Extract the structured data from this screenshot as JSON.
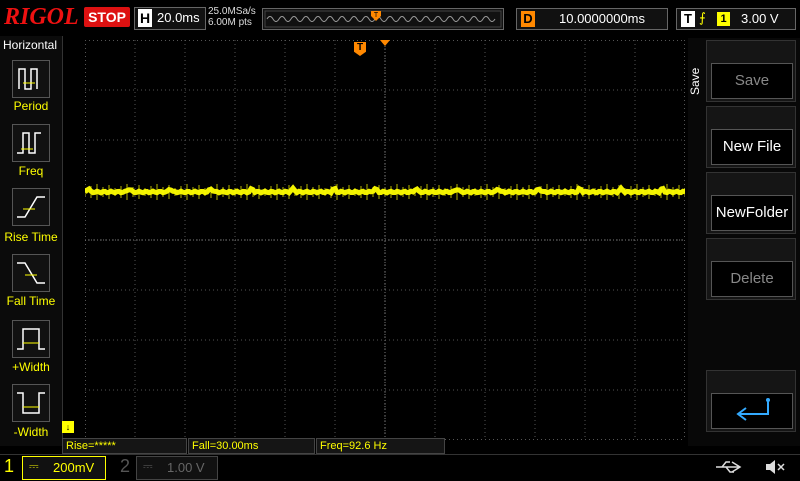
{
  "top": {
    "brand": "RIGOL",
    "run_state": "STOP",
    "horizontal_key": "H",
    "timebase": "20.0ms",
    "sample_rate": "25.0MSa/s",
    "memory_depth": "6.00M pts",
    "delay_key": "D",
    "delay": "10.0000000ms",
    "trigger_key": "T",
    "trigger_edge": "⨍",
    "trigger_channel": "1",
    "trigger_level": "3.00 V"
  },
  "left_menu": {
    "title": "Horizontal",
    "items": [
      {
        "label": "Period"
      },
      {
        "label": "Freq"
      },
      {
        "label": "Rise Time"
      },
      {
        "label": "Fall Time"
      },
      {
        "label": "+Width"
      },
      {
        "label": "-Width"
      }
    ]
  },
  "right_menu": {
    "title": "Save",
    "buttons": [
      {
        "label": "Save",
        "enabled": false
      },
      {
        "label": "New File",
        "enabled": true
      },
      {
        "label": "NewFolder",
        "enabled": true
      },
      {
        "label": "Delete",
        "enabled": false
      }
    ],
    "enter_icon": "enter-icon"
  },
  "measurements": {
    "rise": "Rise=*****",
    "fall": "Fall=30.00ms",
    "freq": "Freq=92.6 Hz"
  },
  "bottom": {
    "ch1_number": "1",
    "ch1_scale": "200mV",
    "ch2_number": "2",
    "ch2_scale": "1.00 V"
  },
  "colors": {
    "ch1": "#ffff00",
    "trigger_marker": "#ff8c00",
    "stop": "#dd1111",
    "grid": "#555555"
  }
}
